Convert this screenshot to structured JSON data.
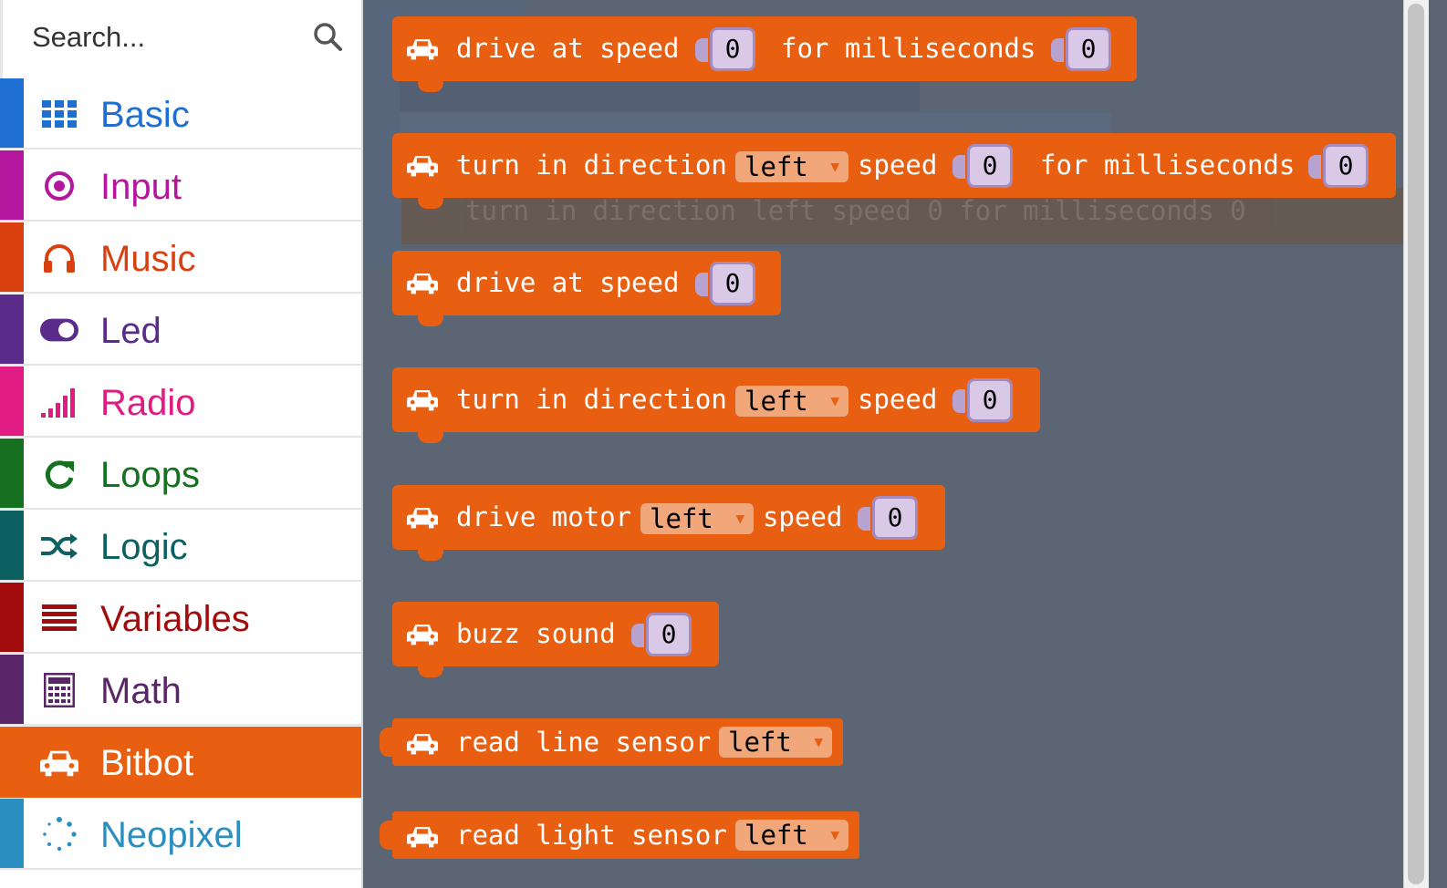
{
  "search": {
    "placeholder": "Search..."
  },
  "categories": [
    {
      "label": "Basic",
      "icon": "grid-icon",
      "color": "#1e6fd1"
    },
    {
      "label": "Input",
      "icon": "target-icon",
      "color": "#b5169e"
    },
    {
      "label": "Music",
      "icon": "headphones-icon",
      "color": "#d9400f"
    },
    {
      "label": "Led",
      "icon": "toggle-icon",
      "color": "#5b2b8c"
    },
    {
      "label": "Radio",
      "icon": "signal-icon",
      "color": "#e01b82"
    },
    {
      "label": "Loops",
      "icon": "refresh-icon",
      "color": "#15711f"
    },
    {
      "label": "Logic",
      "icon": "shuffle-icon",
      "color": "#0d6062"
    },
    {
      "label": "Variables",
      "icon": "list-icon",
      "color": "#a30c0c"
    },
    {
      "label": "Math",
      "icon": "calculator-icon",
      "color": "#5b2569"
    },
    {
      "label": "Bitbot",
      "icon": "car-icon",
      "color": "#e85f12",
      "selected": true
    },
    {
      "label": "Neopixel",
      "icon": "dots-circle-icon",
      "color": "#2b8ec1"
    }
  ],
  "blocks": [
    {
      "words": [
        "drive at speed",
        "for milliseconds"
      ],
      "values": [
        "0",
        "0"
      ]
    },
    {
      "words": [
        "turn in direction",
        "speed",
        "for milliseconds"
      ],
      "dropdown": "left",
      "values": [
        "0",
        "0"
      ]
    },
    {
      "words": [
        "drive at speed"
      ],
      "values": [
        "0"
      ]
    },
    {
      "words": [
        "turn in direction",
        "speed"
      ],
      "dropdown": "left",
      "values": [
        "0"
      ]
    },
    {
      "words": [
        "drive motor",
        "speed"
      ],
      "dropdown": "left",
      "values": [
        "0"
      ]
    },
    {
      "words": [
        "buzz sound"
      ],
      "values": [
        "0"
      ]
    },
    {
      "words": [
        "read line sensor"
      ],
      "dropdown": "left"
    },
    {
      "words": [
        "read light sensor"
      ],
      "dropdown": "left"
    }
  ],
  "ghost": {
    "words": [
      "turn in direction",
      "left",
      "speed",
      "0",
      "for milliseconds",
      "0"
    ]
  }
}
